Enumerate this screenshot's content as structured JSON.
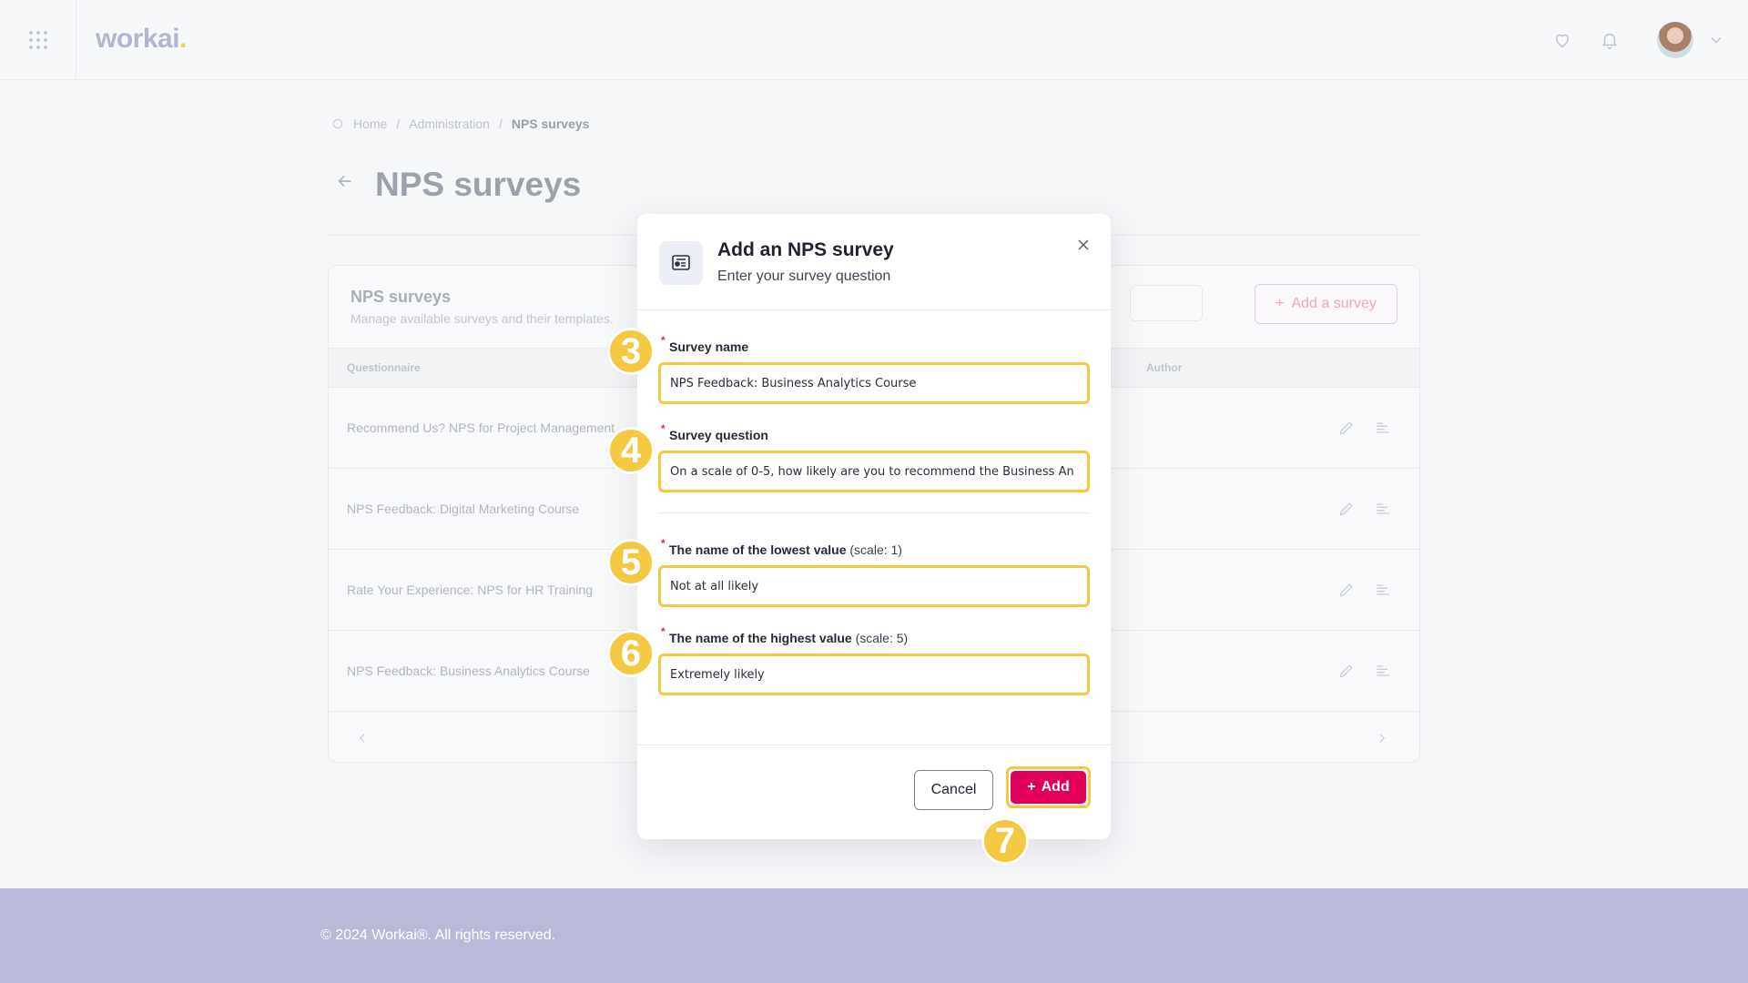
{
  "app": {
    "logo": "workai",
    "logo_dot": "."
  },
  "breadcrumb": [
    "Home",
    "Administration",
    "NPS surveys"
  ],
  "page": {
    "title": "NPS surveys"
  },
  "panel": {
    "title": "NPS surveys",
    "subtitle": "Manage available surveys and their templates.",
    "add_button": "Add a survey",
    "columns": {
      "questionnaire": "Questionnaire",
      "author": "Author"
    },
    "rows": [
      "Recommend Us? NPS for Project Management",
      "NPS Feedback: Digital Marketing Course",
      "Rate Your Experience: NPS for HR Training",
      "NPS Feedback: Business Analytics Course"
    ]
  },
  "modal": {
    "title": "Add an NPS survey",
    "subtitle": "Enter your survey question",
    "fields": {
      "survey_name": {
        "label": "Survey name",
        "value": "NPS Feedback: Business Analytics Course"
      },
      "survey_question": {
        "label": "Survey question",
        "value": "On a scale of 0-5, how likely are you to recommend the Business An"
      },
      "lowest": {
        "label": "The name of the lowest value",
        "hint": "(scale: 1)",
        "value": "Not at all likely"
      },
      "highest": {
        "label": "The name of the highest value",
        "hint": "(scale: 5)",
        "value": "Extremely likely"
      }
    },
    "cancel_label": "Cancel",
    "add_label": "Add"
  },
  "badges": {
    "b3": "3",
    "b4": "4",
    "b5": "5",
    "b6": "6",
    "b7": "7"
  },
  "footer": {
    "copyright": "© 2024 Workai®. All rights reserved."
  },
  "colors": {
    "accent": "#e0005a",
    "highlight": "#f5c842",
    "footer_bg": "#b9bad8"
  }
}
